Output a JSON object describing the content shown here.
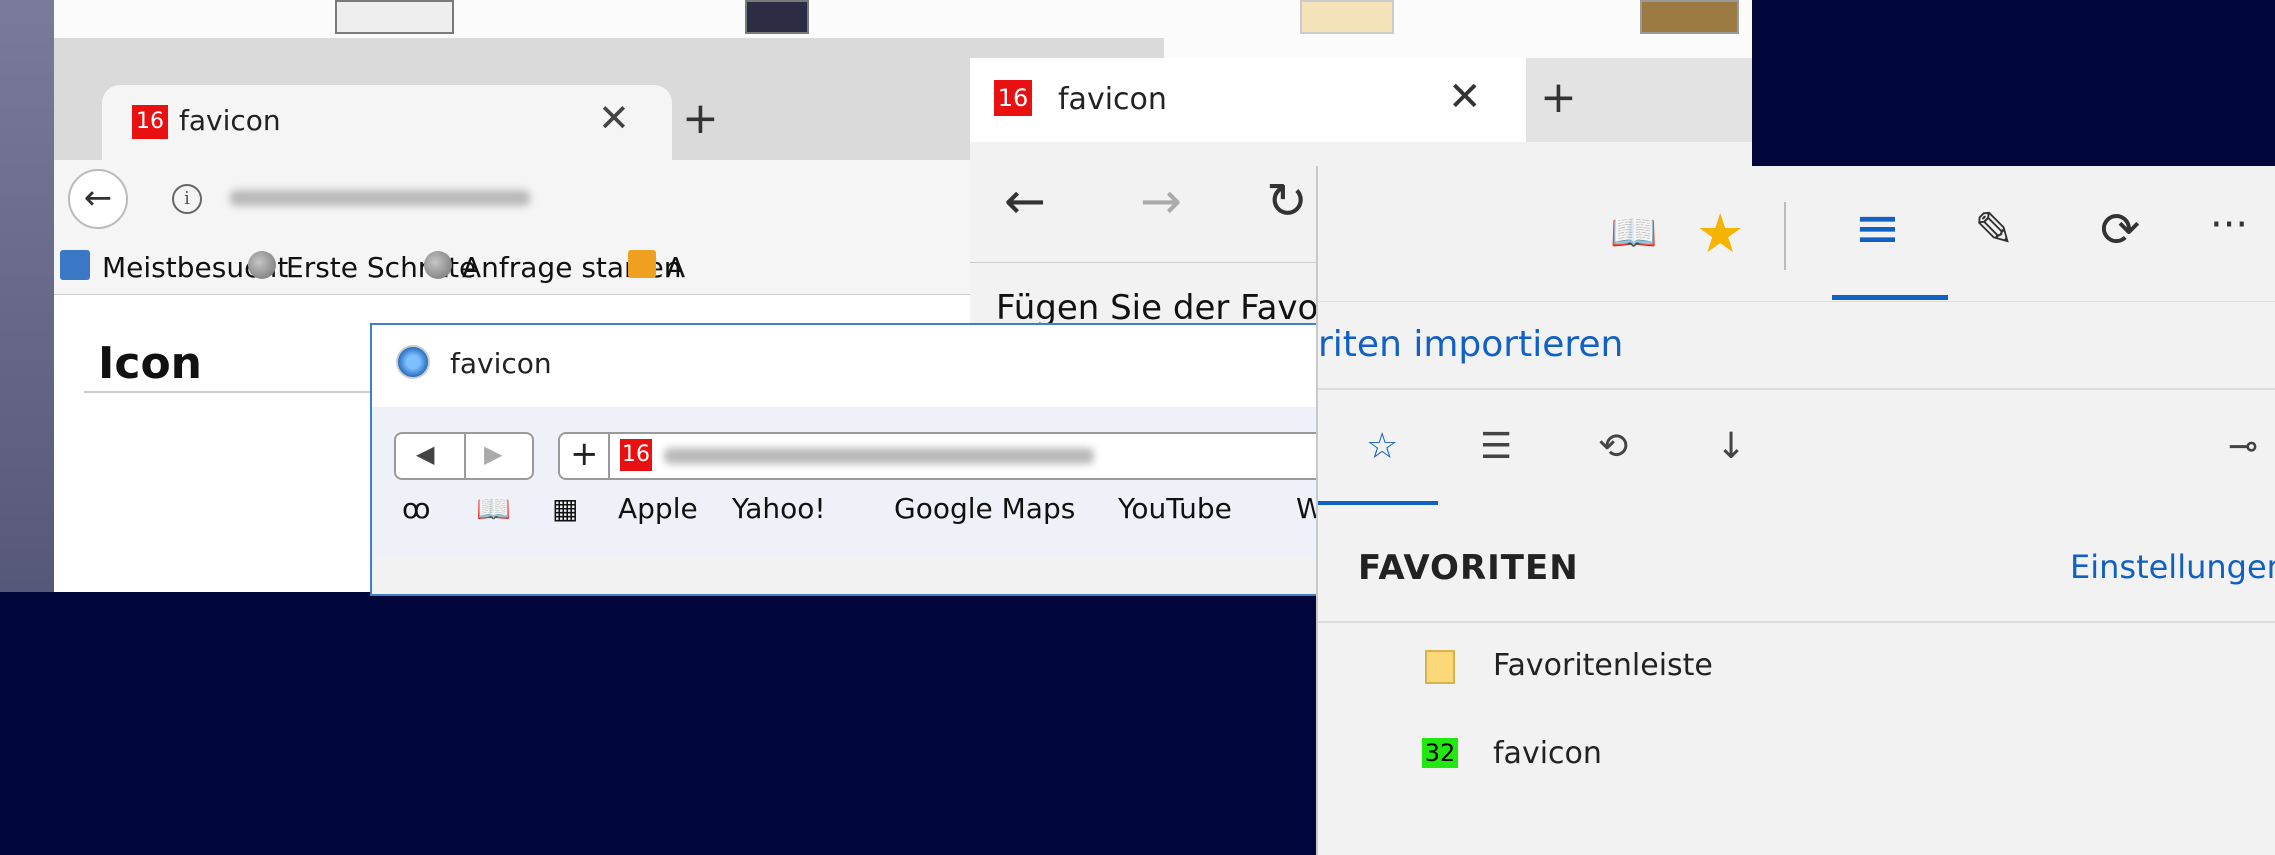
{
  "firefox": {
    "tab_favicon": "16",
    "tab_title": "favicon",
    "close_glyph": "✕",
    "newtab_glyph": "+",
    "back_glyph": "←",
    "info_glyph": "i",
    "bookmarks": [
      "Meistbesucht",
      "Erste Schritte",
      "Anfrage starten",
      "A"
    ],
    "heading": "Icon"
  },
  "safari": {
    "title": "favicon",
    "back_glyph": "◀",
    "forward_glyph": "▶",
    "plus_glyph": "+",
    "url_favicon": "16",
    "glasses_glyph": "ꝏ",
    "book_glyph": "📖",
    "grid_glyph": "▦",
    "bookmarks": [
      "Apple",
      "Yahoo!",
      "Google Maps",
      "YouTube",
      "W"
    ]
  },
  "edge_window": {
    "tab_favicon": "16",
    "tab_title": "favicon",
    "close_glyph": "✕",
    "newtab_glyph": "+",
    "back_glyph": "←",
    "forward_glyph": "→",
    "refresh_glyph": "↻",
    "content_text": "Fügen Sie der Favo"
  },
  "hub": {
    "toolbar": {
      "reading_glyph": "📖",
      "star_glyph": "★",
      "hub_glyph": "≡",
      "note_glyph": "✎",
      "share_glyph": "⟳",
      "more_glyph": "···"
    },
    "import_text": "riten importieren",
    "tabs": {
      "favorites_glyph": "☆",
      "reading_list_glyph": "☰",
      "history_glyph": "⟲",
      "downloads_glyph": "↓",
      "pin_glyph": "⊸"
    },
    "heading": "FAVORITEN",
    "settings": "Einstellungen",
    "items": [
      {
        "label": "Favoritenleiste"
      },
      {
        "label": "favicon",
        "badge": "32"
      }
    ]
  },
  "colors": {
    "accent": "#1160c4",
    "star": "#f5b400",
    "fav16": "#e81010",
    "fav32": "#22e810",
    "background": "#00063a"
  }
}
